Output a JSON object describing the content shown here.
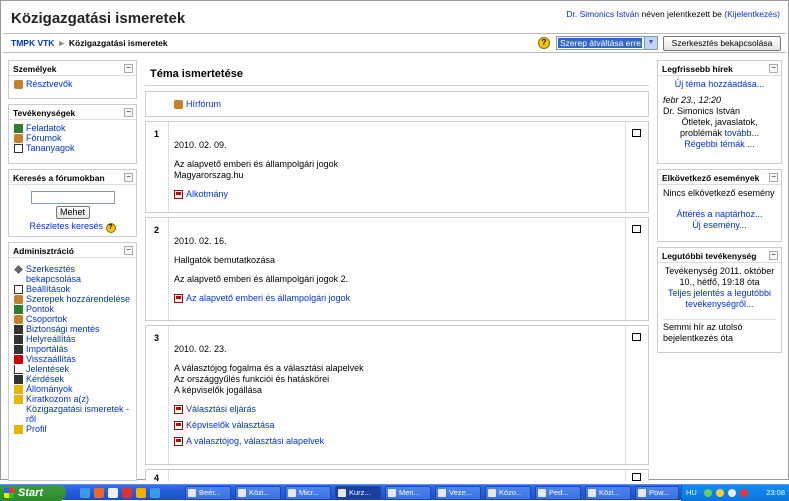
{
  "header": {
    "title": "Közigazgatási ismeretek",
    "user_name": "Dr. Simonics István",
    "logged_in_text": "néven jelentkezett be",
    "logout": "(Kijelentkezés)"
  },
  "navbar": {
    "home": "TMPK VTK",
    "separator": "►",
    "current": "Közigazgatási ismeretek",
    "role_select": "Szerep átváltása erre...",
    "edit_button": "Szerkesztés bekapcsolása"
  },
  "left": {
    "people": {
      "title": "Személyek",
      "items": [
        "Résztvevők"
      ]
    },
    "activities": {
      "title": "Tevékenységek",
      "items": [
        "Feladatok",
        "Fórumok",
        "Tananyagok"
      ]
    },
    "search": {
      "title": "Keresés a fórumokban",
      "button": "Mehet",
      "advanced": "Részletes keresés"
    },
    "admin": {
      "title": "Adminisztráció",
      "items": [
        "Szerkesztés bekapcsolása",
        "Beállítások",
        "Szerepek hozzárendelése",
        "Pontok",
        "Csoportok",
        "Biztonsági mentés",
        "Helyreállítás",
        "Importálás",
        "Visszaállítás",
        "Jelentések",
        "Kérdések",
        "Állományok",
        "Kiratkozom a(z) Közigazgatási ismeretek -ről",
        "Profil"
      ]
    }
  },
  "main": {
    "heading": "Téma ismertetése",
    "forum": "Hírfórum",
    "sections": [
      {
        "num": "1",
        "date": "2010. 02. 09.",
        "lines": [
          "Az alapvető emberi és állampolgári jogok",
          "Magyarorszag.hu"
        ],
        "resources": [
          "Alkotmány"
        ]
      },
      {
        "num": "2",
        "date": "2010. 02. 16.",
        "lines": [
          "Hallgatók bemutatkozása",
          "Az alapvető emberi és állampolgári jogok 2."
        ],
        "resources": [
          "Az alapvető emberi és állampolgári jogok"
        ]
      },
      {
        "num": "3",
        "date": "2010. 02. 23.",
        "lines": [
          "A választójog fogalma és a választási alapelvek",
          "Az országgyűlés funkciói és hatáskörei",
          "A képviselők jogállása"
        ],
        "resources": [
          "Választási eljárás",
          "Képviselők választása",
          "A választójog, választási alapelvek"
        ]
      },
      {
        "num": "4"
      }
    ]
  },
  "right": {
    "news": {
      "title": "Legfrissebb hírek",
      "add": "Új téma hozzáadása...",
      "date": "febr 23., 12:20",
      "author": "Dr. Simonics István",
      "text": "Ötletek, javaslatok, problémák",
      "more": "tovább...",
      "older": "Régebbi témák ..."
    },
    "events": {
      "title": "Elkövetkező események",
      "none": "Nincs elkövetkező esemény",
      "calendar": "Áttérés a naptárhoz...",
      "new": "Új esemény..."
    },
    "recent": {
      "title": "Legutóbbi tevékenység",
      "since": "Tevékenység 2011. október 10., hétfő, 19:18 óta",
      "full": "Teljes jelentés a legutóbbi tevékenységről...",
      "nothing": "Semmi hír az utolsó bejelentkezés óta"
    }
  },
  "taskbar": {
    "start": "Start",
    "buttons": [
      "Beér...",
      "Közi...",
      "Micr...",
      "Kurz...",
      "Men...",
      "Veze...",
      "Közo...",
      "Ped...",
      "Közi...",
      "Pow..."
    ],
    "tray_lang": "HU",
    "clock": "23:08"
  }
}
